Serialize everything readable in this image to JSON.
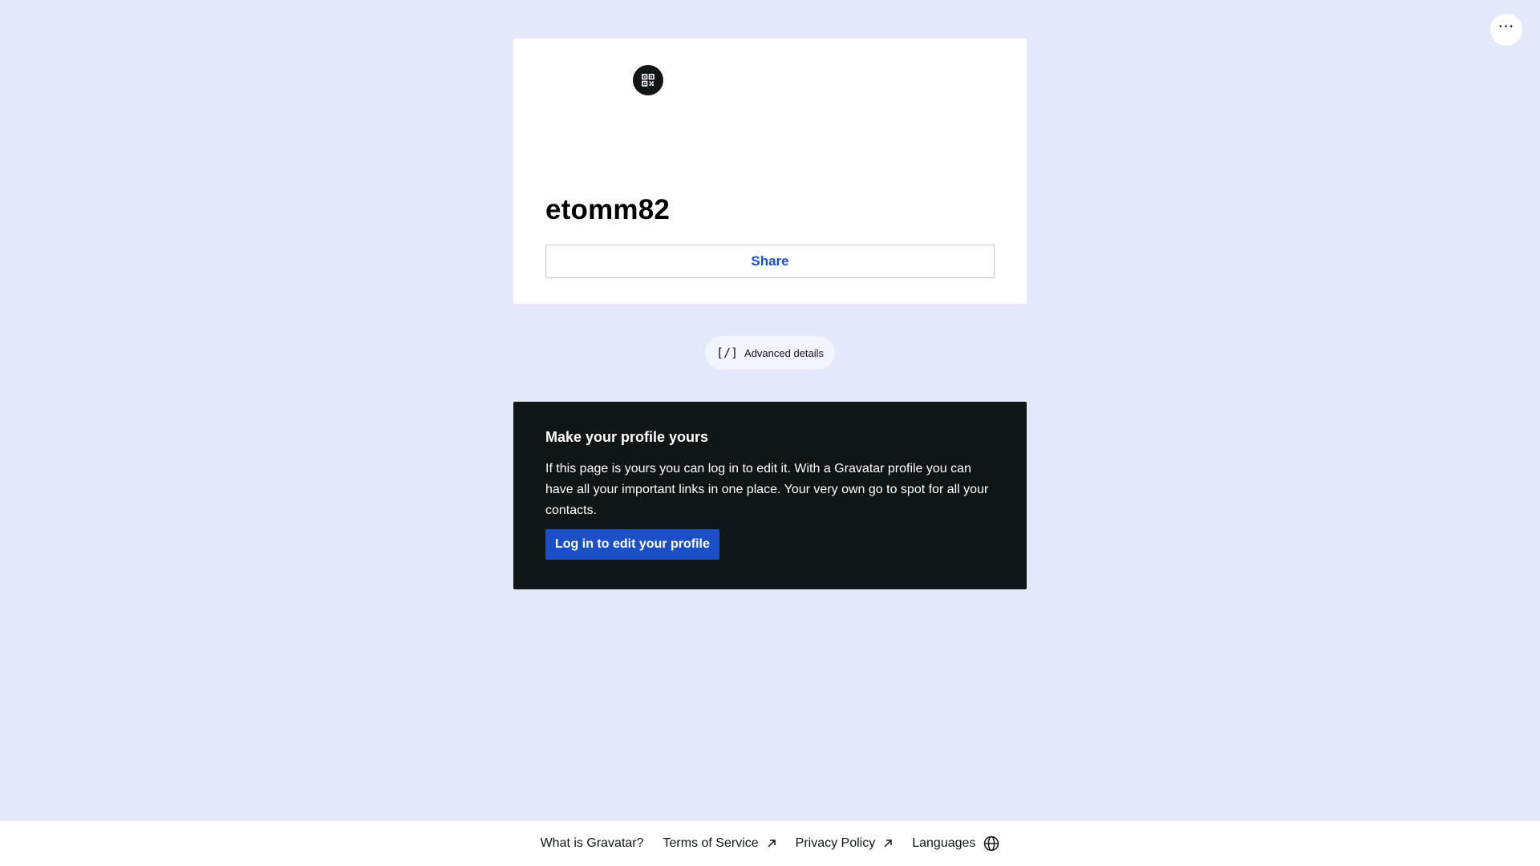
{
  "header": {
    "more_menu_label": "⋯",
    "more_menu_icon": "ellipsis-icon"
  },
  "profile": {
    "qr_icon": "qr-code-icon",
    "display_name": "etomm82",
    "share_label": "Share"
  },
  "advanced": {
    "icon_text": "[/]",
    "label": "Advanced details"
  },
  "promo": {
    "title": "Make your profile yours",
    "text": "If this page is yours you can log in to edit it. With a Gravatar profile you can have all your important links in one place. Your very own go to spot for all your contacts.",
    "login_label": "Log in to edit your profile"
  },
  "footer": {
    "links": [
      {
        "label": "What is Gravatar?",
        "icon": ""
      },
      {
        "label": "Terms of Service",
        "icon": "external-arrow-icon"
      },
      {
        "label": "Privacy Policy",
        "icon": "external-arrow-icon"
      },
      {
        "label": "Languages",
        "icon": "globe-icon"
      }
    ]
  },
  "colors": {
    "page_background": "#e3e9fa",
    "accent_blue": "#1d4fc4",
    "dark_card": "#101517",
    "card_background": "#ffffff"
  }
}
